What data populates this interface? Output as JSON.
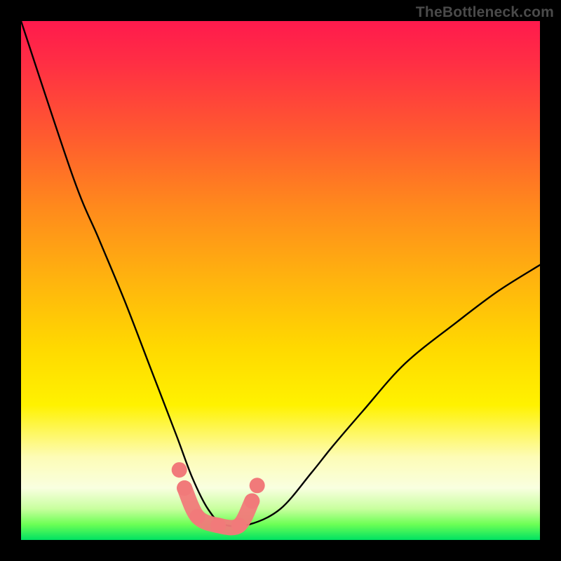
{
  "attribution": {
    "label": "TheBottleneck.com"
  },
  "chart_data": {
    "type": "line",
    "title": "",
    "xlabel": "",
    "ylabel": "",
    "x_range": [
      0,
      1
    ],
    "y_range": [
      0,
      1
    ],
    "series": [
      {
        "name": "bottleneck-curve",
        "x": [
          0.0,
          0.1,
          0.15,
          0.2,
          0.25,
          0.3,
          0.33,
          0.36,
          0.39,
          0.44,
          0.5,
          0.56,
          0.6,
          0.66,
          0.74,
          0.84,
          0.92,
          1.0
        ],
        "y": [
          1.0,
          0.7,
          0.58,
          0.46,
          0.33,
          0.2,
          0.12,
          0.06,
          0.03,
          0.03,
          0.06,
          0.13,
          0.18,
          0.25,
          0.34,
          0.42,
          0.48,
          0.53
        ]
      },
      {
        "name": "marker-band",
        "x": [
          0.315,
          0.34,
          0.38,
          0.42,
          0.445
        ],
        "y": [
          0.1,
          0.045,
          0.028,
          0.028,
          0.075
        ]
      }
    ],
    "curve_color": "#000000",
    "marker_color": "#f17a7a",
    "background": "heatmap-gradient-red-to-green"
  },
  "colors": {
    "gradient_top": "#ff1a4d",
    "gradient_mid": "#ffd900",
    "gradient_bottom": "#00e262",
    "curve": "#000000",
    "markers": "#f17a7a",
    "frame": "#000000",
    "attribution_text": "#4a4a4a"
  }
}
